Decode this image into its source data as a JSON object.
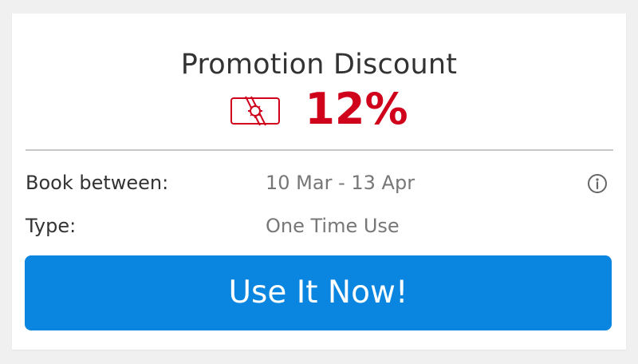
{
  "promotion": {
    "title": "Promotion Discount",
    "discount_value": "12%",
    "icon": "coupon-icon"
  },
  "details": {
    "book_between": {
      "label": "Book between:",
      "value": "10 Mar - 13 Apr",
      "info_icon": "info-icon"
    },
    "type": {
      "label": "Type:",
      "value": "One Time Use"
    }
  },
  "cta": {
    "label": "Use It Now!"
  },
  "colors": {
    "accent": "#d0021b",
    "button": "#0a85e0",
    "text": "#333333",
    "muted_text": "#777777",
    "background": "#f0f0f0"
  }
}
